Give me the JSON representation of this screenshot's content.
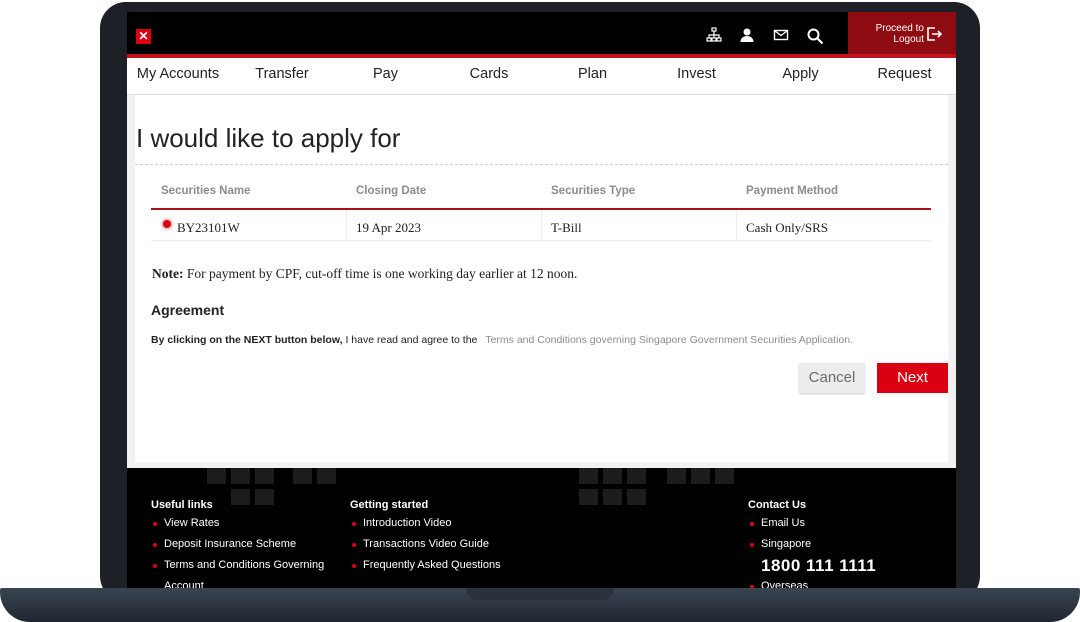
{
  "header": {
    "proceed_line1": "Proceed to",
    "proceed_line2": "Logout",
    "icons": [
      "sitemap-icon",
      "profile-icon",
      "mail-icon",
      "search-icon",
      "logout-icon"
    ]
  },
  "nav": {
    "items": [
      "My Accounts",
      "Transfer",
      "Pay",
      "Cards",
      "Plan",
      "Invest",
      "Apply",
      "Request"
    ]
  },
  "main": {
    "title": "I would like to apply for",
    "table": {
      "headers": [
        "Securities Name",
        "Closing Date",
        "Securities Type",
        "Payment Method"
      ],
      "rows": [
        [
          "BY23101W",
          "19 Apr 2023",
          "T-Bill",
          "Cash Only/SRS"
        ]
      ]
    },
    "note_label": "Note:",
    "note_text": "For payment by CPF, cut-off time is one working day earlier at 12 noon.",
    "agreement_title": "Agreement",
    "agreement_bold": "By clicking on the NEXT button below,",
    "agreement_text": "I have read and agree to the",
    "agreement_link": "Terms and Conditions governing Singapore Government Securities Application.",
    "cancel_label": "Cancel",
    "next_label": "Next"
  },
  "footer": {
    "useful_links": {
      "title": "Useful links",
      "items": [
        "View Rates",
        "Deposit Insurance Scheme",
        "Terms and Conditions Governing",
        "Account"
      ]
    },
    "getting_started": {
      "title": "Getting started",
      "items": [
        "Introduction Video",
        "Transactions Video Guide",
        "Frequently Asked Questions"
      ]
    },
    "contact": {
      "title": "Contact Us",
      "email": "Email Us",
      "singapore": "Singapore",
      "phone": "1800 111 1111",
      "overseas": "Overseas"
    }
  },
  "colors": {
    "brand_red": "#db0011",
    "header_bg": "#000000",
    "logout_bg": "#8f0b12"
  }
}
